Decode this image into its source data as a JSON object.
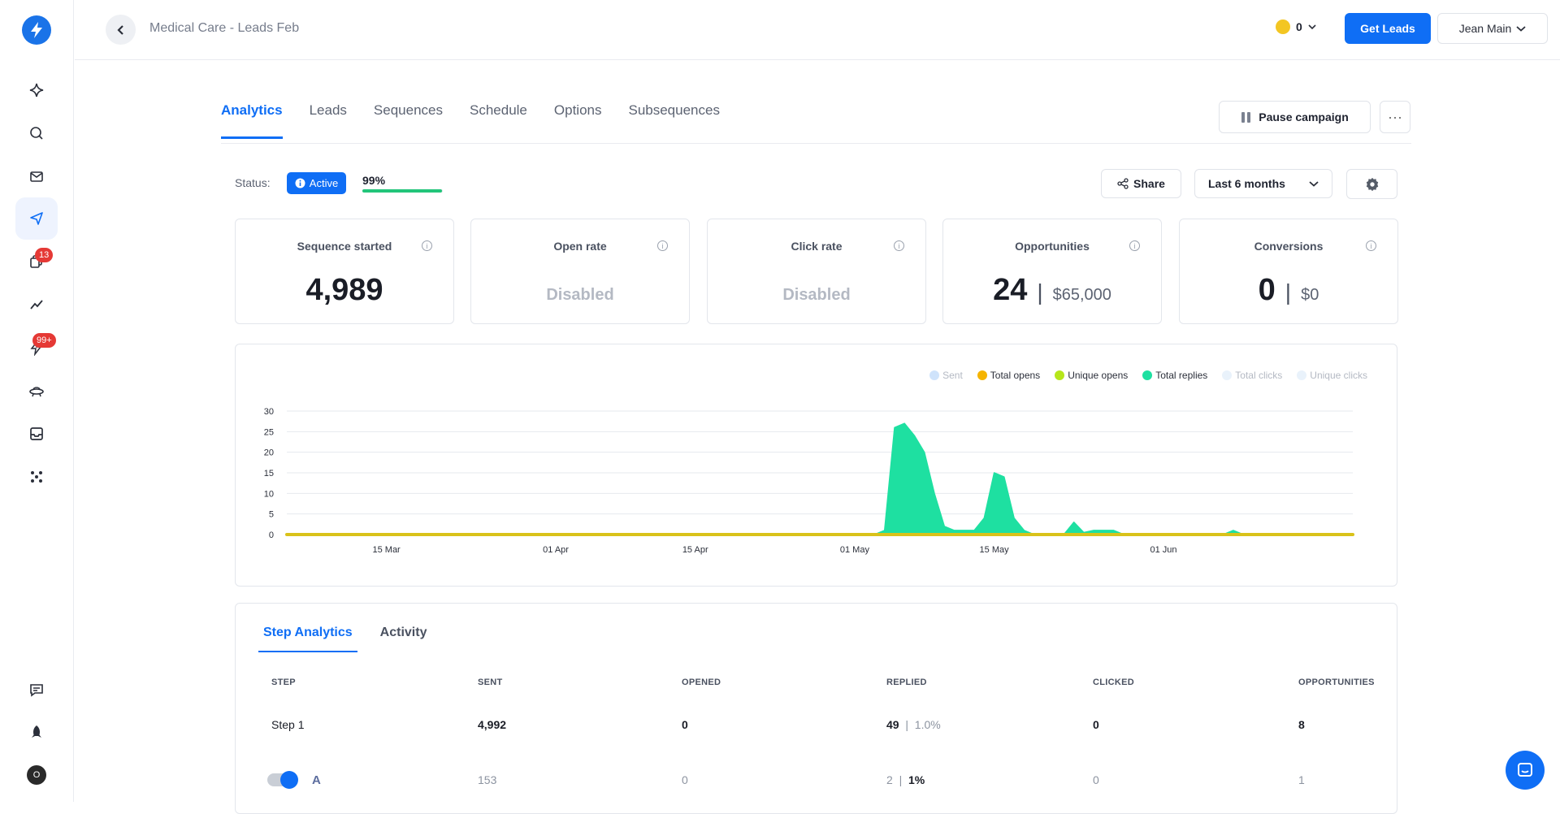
{
  "sidebar": {
    "items": [
      {
        "name": "sparkle-icon"
      },
      {
        "name": "search-icon"
      },
      {
        "name": "mail-icon"
      },
      {
        "name": "send-icon"
      },
      {
        "name": "copy-icon",
        "badge": "13"
      },
      {
        "name": "trend-icon"
      },
      {
        "name": "bolt-icon",
        "badge": "99+"
      },
      {
        "name": "ufo-icon"
      },
      {
        "name": "inbox-icon"
      },
      {
        "name": "apps-icon"
      },
      {
        "name": "feedback-icon"
      },
      {
        "name": "rocket-icon"
      }
    ],
    "avatar_initial": "O"
  },
  "header": {
    "breadcrumb": "Medical Care - Leads Feb",
    "credits": "0",
    "get_leads_label": "Get Leads",
    "user_name": "Jean Main"
  },
  "tabs": [
    "Analytics",
    "Leads",
    "Sequences",
    "Schedule",
    "Options",
    "Subsequences"
  ],
  "actions": {
    "pause_label": "Pause campaign",
    "more_label": "···",
    "share_label": "Share",
    "range_label": "Last 6 months"
  },
  "status": {
    "label": "Status:",
    "value": "Active",
    "progress_text": "99%",
    "progress": 0.99,
    "progress_color": "#22c57a"
  },
  "cards": [
    {
      "title": "Sequence started",
      "value": "4,989"
    },
    {
      "title": "Open rate",
      "disabled": "Disabled"
    },
    {
      "title": "Click rate",
      "disabled": "Disabled"
    },
    {
      "title": "Opportunities",
      "value": "24",
      "money": "$65,000"
    },
    {
      "title": "Conversions",
      "value": "0",
      "money": "$0"
    }
  ],
  "chart_data": {
    "type": "area",
    "x_ticks": [
      "15 Mar",
      "01 Apr",
      "15 Apr",
      "01 May",
      "15 May",
      "01 Jun"
    ],
    "ylim": [
      0,
      30
    ],
    "y_ticks": [
      "30",
      "25",
      "20",
      "15",
      "10",
      "5",
      "0"
    ],
    "legend": [
      {
        "name": "Sent",
        "color": "#cfe3fb",
        "active": false
      },
      {
        "name": "Total opens",
        "color": "#f5b400",
        "active": true
      },
      {
        "name": "Unique opens",
        "color": "#b6e61b",
        "active": true
      },
      {
        "name": "Total replies",
        "color": "#1ee0a1",
        "active": true
      },
      {
        "name": "Total clicks",
        "color": "#e9f2fb",
        "active": false
      },
      {
        "name": "Unique clicks",
        "color": "#e9f2fb",
        "active": false
      }
    ],
    "series": [
      {
        "name": "Total replies",
        "color": "#1ee0a1",
        "points": [
          [
            "2024-03-05",
            0
          ],
          [
            "2024-05-03",
            0
          ],
          [
            "2024-05-04",
            1
          ],
          [
            "2024-05-05",
            26
          ],
          [
            "2024-05-06",
            27
          ],
          [
            "2024-05-07",
            24
          ],
          [
            "2024-05-08",
            20
          ],
          [
            "2024-05-09",
            10
          ],
          [
            "2024-05-10",
            2
          ],
          [
            "2024-05-11",
            1
          ],
          [
            "2024-05-13",
            1
          ],
          [
            "2024-05-14",
            4
          ],
          [
            "2024-05-15",
            15
          ],
          [
            "2024-05-16",
            14
          ],
          [
            "2024-05-17",
            4
          ],
          [
            "2024-05-18",
            1
          ],
          [
            "2024-05-19",
            0
          ],
          [
            "2024-05-22",
            0
          ],
          [
            "2024-05-23",
            3
          ],
          [
            "2024-05-24",
            0.5
          ],
          [
            "2024-05-25",
            1
          ],
          [
            "2024-05-27",
            1
          ],
          [
            "2024-05-28",
            0
          ],
          [
            "2024-06-07",
            0
          ],
          [
            "2024-06-08",
            1
          ],
          [
            "2024-06-09",
            0
          ],
          [
            "2024-06-20",
            0
          ]
        ]
      },
      {
        "name": "Total opens",
        "color": "#d9c21a",
        "points": [
          [
            "2024-03-05",
            0
          ],
          [
            "2024-06-20",
            0
          ]
        ]
      }
    ]
  },
  "steps": {
    "tabs": [
      "Step Analytics",
      "Activity"
    ],
    "columns": [
      "STEP",
      "SENT",
      "OPENED",
      "REPLIED",
      "CLICKED",
      "OPPORTUNITIES"
    ],
    "row": {
      "step": "Step 1",
      "sent": "4,992",
      "opened": "0",
      "replied": "49",
      "replied_pct": "1.0%",
      "clicked": "0",
      "opps": "8"
    },
    "variant": {
      "name": "A",
      "sent": "153",
      "opened": "0",
      "replied": "2",
      "replied_pct": "1%",
      "clicked": "0",
      "opps": "1"
    }
  }
}
